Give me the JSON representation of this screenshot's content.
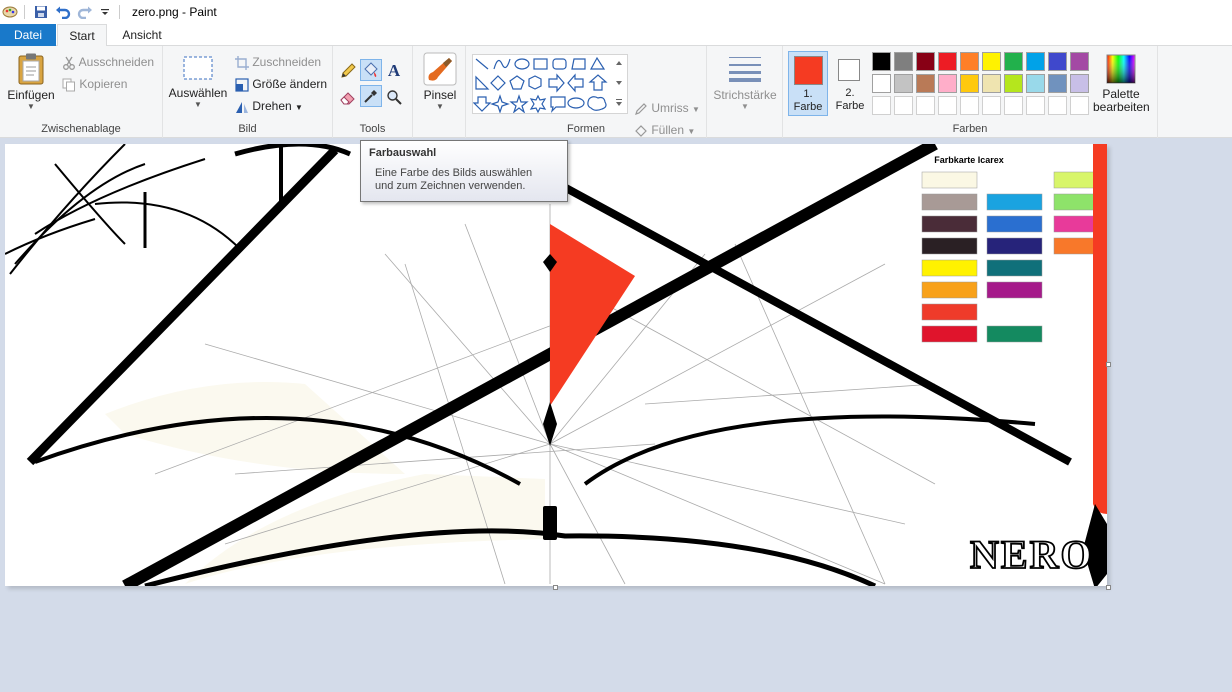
{
  "window": {
    "title": "zero.png - Paint"
  },
  "tabs": {
    "file": "Datei",
    "start": "Start",
    "view": "Ansicht"
  },
  "clipboard": {
    "paste": "Einfügen",
    "cut": "Ausschneiden",
    "copy": "Kopieren",
    "label": "Zwischenablage"
  },
  "image": {
    "select": "Auswählen",
    "crop": "Zuschneiden",
    "resize": "Größe ändern",
    "rotate": "Drehen",
    "label": "Bild"
  },
  "tools": {
    "label": "Tools"
  },
  "brushes": {
    "label": "Pinsel"
  },
  "shapes": {
    "outline": "Umriss",
    "fill": "Füllen",
    "label": "Formen"
  },
  "stroke": {
    "label": "Strichstärke"
  },
  "colors": {
    "color1_label_a": "1.",
    "color1_label_b": "Farbe",
    "color2_label_a": "2.",
    "color2_label_b": "Farbe",
    "color1": "#f53b22",
    "color2": "#ffffff",
    "edit_a": "Palette",
    "edit_b": "bearbeiten",
    "label": "Farben",
    "palette_row1": [
      "#000000",
      "#7f7f7f",
      "#880015",
      "#ed1c24",
      "#ff7f27",
      "#fff200",
      "#22b14c",
      "#00a2e8",
      "#3f48cc",
      "#a349a4"
    ],
    "palette_row2": [
      "#ffffff",
      "#c3c3c3",
      "#b97a57",
      "#ffaec9",
      "#ffc90e",
      "#efe4b0",
      "#b5e61d",
      "#99d9ea",
      "#7092be",
      "#c8bfe7"
    ]
  },
  "tooltip": {
    "title": "Farbauswahl",
    "line1": "Eine Farbe des Bilds auswählen",
    "line2": "und zum Zeichnen verwenden."
  },
  "drawing": {
    "card_title": "Farbkarte Icarex",
    "logo": "NERO"
  }
}
